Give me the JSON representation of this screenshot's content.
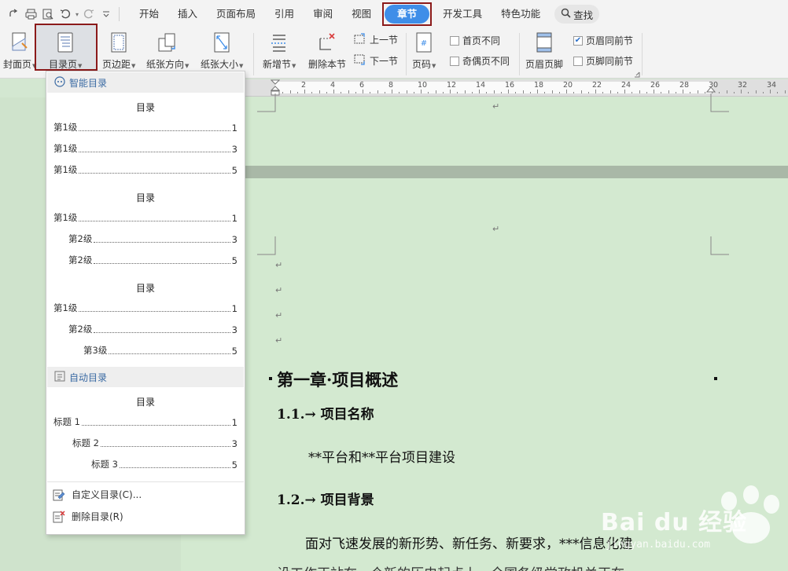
{
  "quick_access": {
    "icons": [
      "share-icon",
      "print-icon",
      "print-preview-icon",
      "undo-icon",
      "redo-icon",
      "customize-icon"
    ]
  },
  "menubar": {
    "tabs": [
      {
        "label": "开始"
      },
      {
        "label": "插入"
      },
      {
        "label": "页面布局"
      },
      {
        "label": "引用"
      },
      {
        "label": "审阅"
      },
      {
        "label": "视图"
      },
      {
        "label": "章节",
        "active": true
      },
      {
        "label": "开发工具"
      },
      {
        "label": "特色功能"
      }
    ],
    "search_label": "查找",
    "accent_color": "#3f8ee8"
  },
  "ribbon": {
    "cover_page": "封面页",
    "toc_page": "目录页",
    "page_margin": "页边距",
    "orientation": "纸张方向",
    "paper_size": "纸张大小",
    "new_section": "新增节",
    "delete_section": "删除本节",
    "prev_section": "上一节",
    "next_section": "下一节",
    "page_number": "页码",
    "first_page_diff": "首页不同",
    "odd_even_diff": "奇偶页不同",
    "header_footer": "页眉页脚",
    "header_same": "页眉同前节",
    "footer_same": "页脚同前节",
    "header_same_checked": true,
    "footer_same_checked": false
  },
  "ruler": {
    "numbers": [
      "2",
      "4",
      "6",
      "8",
      "10",
      "12",
      "14",
      "16",
      "18",
      "20",
      "22",
      "24",
      "26",
      "28",
      "30",
      "32",
      "34"
    ]
  },
  "dropdown": {
    "smart_toc_header": "智能目录",
    "auto_toc_header": "自动目录",
    "toc_title": "目录",
    "smart_tocs": [
      {
        "rows": [
          {
            "text": "第1级",
            "page": "1",
            "level": 1
          },
          {
            "text": "第1级",
            "page": "3",
            "level": 1
          },
          {
            "text": "第1级",
            "page": "5",
            "level": 1
          }
        ]
      },
      {
        "rows": [
          {
            "text": "第1级",
            "page": "1",
            "level": 1
          },
          {
            "text": "第2级",
            "page": "3",
            "level": 2
          },
          {
            "text": "第2级",
            "page": "5",
            "level": 2
          }
        ]
      },
      {
        "rows": [
          {
            "text": "第1级",
            "page": "1",
            "level": 1
          },
          {
            "text": "第2级",
            "page": "3",
            "level": 2
          },
          {
            "text": "第3级",
            "page": "5",
            "level": 3
          }
        ]
      }
    ],
    "auto_toc": {
      "rows": [
        {
          "text": "标题 1",
          "page": "1",
          "level": 1
        },
        {
          "text": "标题 2",
          "page": "3",
          "level": 2
        },
        {
          "text": "标题 3",
          "page": "5",
          "level": 3
        }
      ]
    },
    "custom_toc": "自定义目录(C)...",
    "delete_toc": "删除目录(R)"
  },
  "document": {
    "chapter_title": "第一章·项目概述",
    "h11": "1.1.→ 项目名称",
    "body1": "**平台和**平台项目建设",
    "h12": "1.2.→ 项目背景",
    "body2": "面对飞速发展的新形势、新任务、新要求，***信息化建",
    "body3": "设工作正站在一个新的历史起点上，全国各级党政机关正在",
    "para_mark": "↵"
  },
  "watermark": {
    "text": "Bai du 经验",
    "sub": "jingyan.baidu.com"
  }
}
